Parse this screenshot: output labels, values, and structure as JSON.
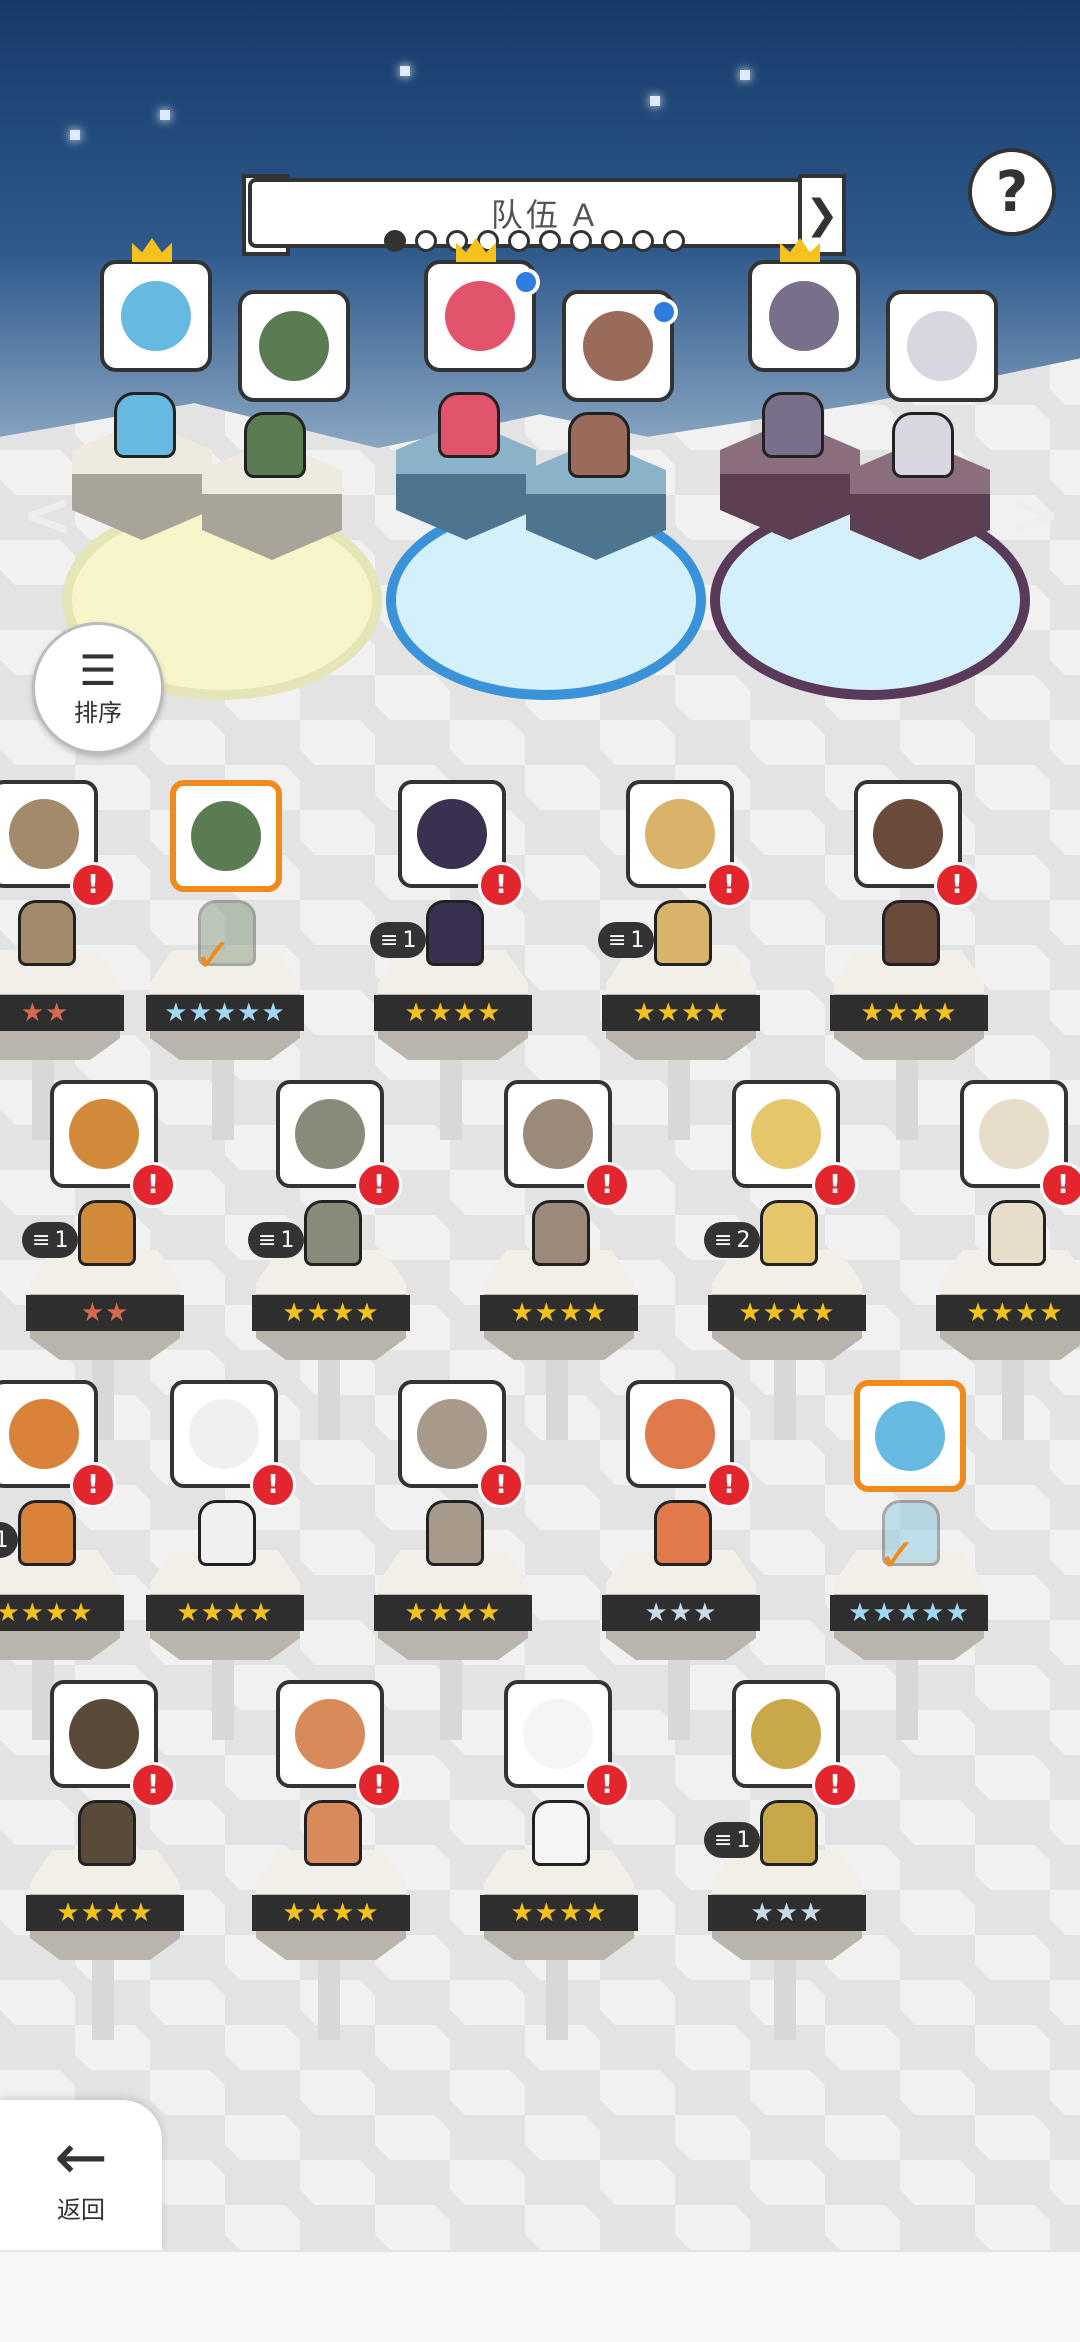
{
  "header": {
    "team_title": "队伍 A",
    "prev_team_label": "❮",
    "next_team_label": "❯",
    "page_count": 10,
    "active_page": 1,
    "help_label": "?"
  },
  "team": {
    "prev_label": "<",
    "next_label": ">",
    "slots": [
      {
        "id": "slot-1",
        "ring": "yellow",
        "members": [
          {
            "id": "aqua-hair",
            "leader": true,
            "color": "#66b9e0"
          },
          {
            "id": "green-witch",
            "leader": false,
            "color": "#5b7c52"
          }
        ]
      },
      {
        "id": "slot-2",
        "ring": "blue",
        "members": [
          {
            "id": "red-hair",
            "leader": true,
            "color": "#e2546c"
          },
          {
            "id": "brown-hair",
            "leader": false,
            "color": "#9a6a5a"
          }
        ]
      },
      {
        "id": "slot-3",
        "ring": "purple",
        "members": [
          {
            "id": "dark-knight",
            "leader": true,
            "color": "#7a6f8a"
          },
          {
            "id": "white-hair",
            "leader": false,
            "color": "#d9d6e0"
          }
        ]
      }
    ]
  },
  "sort": {
    "label": "排序",
    "icon": "sort-icon"
  },
  "roster": [
    {
      "stars": "★★",
      "star_style": "red",
      "badge": "",
      "color": "#a28a6a",
      "selected": false,
      "alert": true
    },
    {
      "stars": "★★★★★",
      "star_style": "rainbow",
      "badge": "",
      "color": "#5b7c52",
      "selected": true,
      "alert": false
    },
    {
      "stars": "★★★★",
      "star_style": "gold",
      "badge": "1",
      "color": "#3a3050",
      "selected": false,
      "alert": true
    },
    {
      "stars": "★★★★",
      "star_style": "gold",
      "badge": "1",
      "color": "#d9b36a",
      "selected": false,
      "alert": true
    },
    {
      "stars": "★★★★",
      "star_style": "gold",
      "badge": "",
      "color": "#6a4a3a",
      "selected": false,
      "alert": true
    },
    {
      "stars": "★★",
      "star_style": "red",
      "badge": "1",
      "color": "#d08a3a",
      "selected": false,
      "alert": true
    },
    {
      "stars": "★★★★",
      "star_style": "gold",
      "badge": "1",
      "color": "#8a8a7a",
      "selected": false,
      "alert": true
    },
    {
      "stars": "★★★★",
      "star_style": "gold",
      "badge": "",
      "color": "#9b8a7a",
      "selected": false,
      "alert": true
    },
    {
      "stars": "★★★★",
      "star_style": "gold",
      "badge": "2",
      "color": "#e6c66a",
      "selected": false,
      "alert": true
    },
    {
      "stars": "★★★★",
      "star_style": "gold",
      "badge": "",
      "color": "#e8dccb",
      "selected": false,
      "alert": true
    },
    {
      "stars": "★★★★",
      "star_style": "gold",
      "badge": "1",
      "color": "#d8823a",
      "selected": false,
      "alert": true
    },
    {
      "stars": "★★★★",
      "star_style": "gold",
      "badge": "",
      "color": "#f0f0f0",
      "selected": false,
      "alert": true
    },
    {
      "stars": "★★★★",
      "star_style": "gold",
      "badge": "",
      "color": "#a89a8a",
      "selected": false,
      "alert": true
    },
    {
      "stars": "★★★",
      "star_style": "silver",
      "badge": "",
      "color": "#e07a4a",
      "selected": false,
      "alert": true
    },
    {
      "stars": "★★★★★",
      "star_style": "rainbow",
      "badge": "",
      "color": "#66b9e0",
      "selected": true,
      "alert": false
    },
    {
      "stars": "★★★★",
      "star_style": "gold",
      "badge": "",
      "color": "#5a4a3a",
      "selected": false,
      "alert": true
    },
    {
      "stars": "★★★★",
      "star_style": "gold",
      "badge": "",
      "color": "#d88a5a",
      "selected": false,
      "alert": true
    },
    {
      "stars": "★★★★",
      "star_style": "gold",
      "badge": "",
      "color": "#f5f5f5",
      "selected": false,
      "alert": true
    },
    {
      "stars": "★★★",
      "star_style": "silver",
      "badge": "1",
      "color": "#c9a84a",
      "selected": false,
      "alert": true
    }
  ],
  "alert_label": "!",
  "back": {
    "label": "返回",
    "icon": "back-arrow-icon",
    "glyph": "←"
  }
}
